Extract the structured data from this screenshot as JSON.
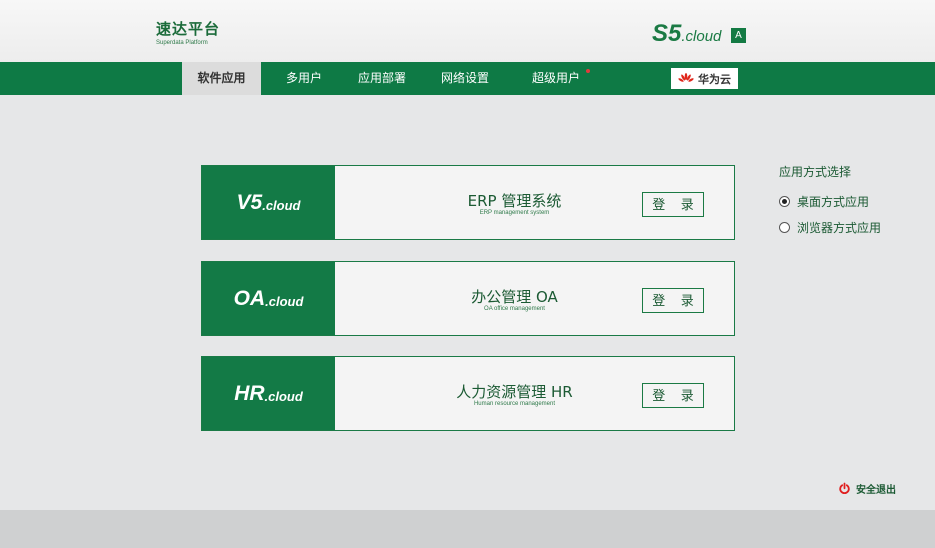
{
  "brand": {
    "title": "速达平台",
    "subtitle": "Superdata Platform"
  },
  "product_logo": {
    "main": "S5",
    "suffix": ".cloud"
  },
  "user_badge": "A",
  "nav": {
    "items": [
      {
        "label": "软件应用",
        "active": true
      },
      {
        "label": "多用户",
        "active": false
      },
      {
        "label": "应用部署",
        "active": false
      },
      {
        "label": "网络设置",
        "active": false
      },
      {
        "label": "超级用户",
        "active": false,
        "notification_dot": true
      }
    ],
    "partner": {
      "label": "华为云",
      "icon": "huawei-icon"
    }
  },
  "apps": [
    {
      "logo_main": "V5",
      "logo_suffix": ".cloud",
      "title": "ERP 管理系统",
      "subtitle": "ERP management system",
      "login_label": "登 录"
    },
    {
      "logo_main": "OA",
      "logo_suffix": ".cloud",
      "title": "办公管理 OA",
      "subtitle": "OA office management",
      "login_label": "登 录"
    },
    {
      "logo_main": "HR",
      "logo_suffix": ".cloud",
      "title": "人力资源管理 HR",
      "subtitle": "Human resource management",
      "login_label": "登 录"
    }
  ],
  "app_mode": {
    "title": "应用方式选择",
    "options": [
      {
        "label": "桌面方式应用",
        "checked": true
      },
      {
        "label": "浏览器方式应用",
        "checked": false
      }
    ]
  },
  "logout": {
    "label": "安全退出",
    "icon": "power-icon"
  },
  "colors": {
    "brand_green": "#0e7a45",
    "dark_green_text": "#1b5a33",
    "page_bg": "#e6e7e8",
    "logout_red": "#e02020"
  }
}
